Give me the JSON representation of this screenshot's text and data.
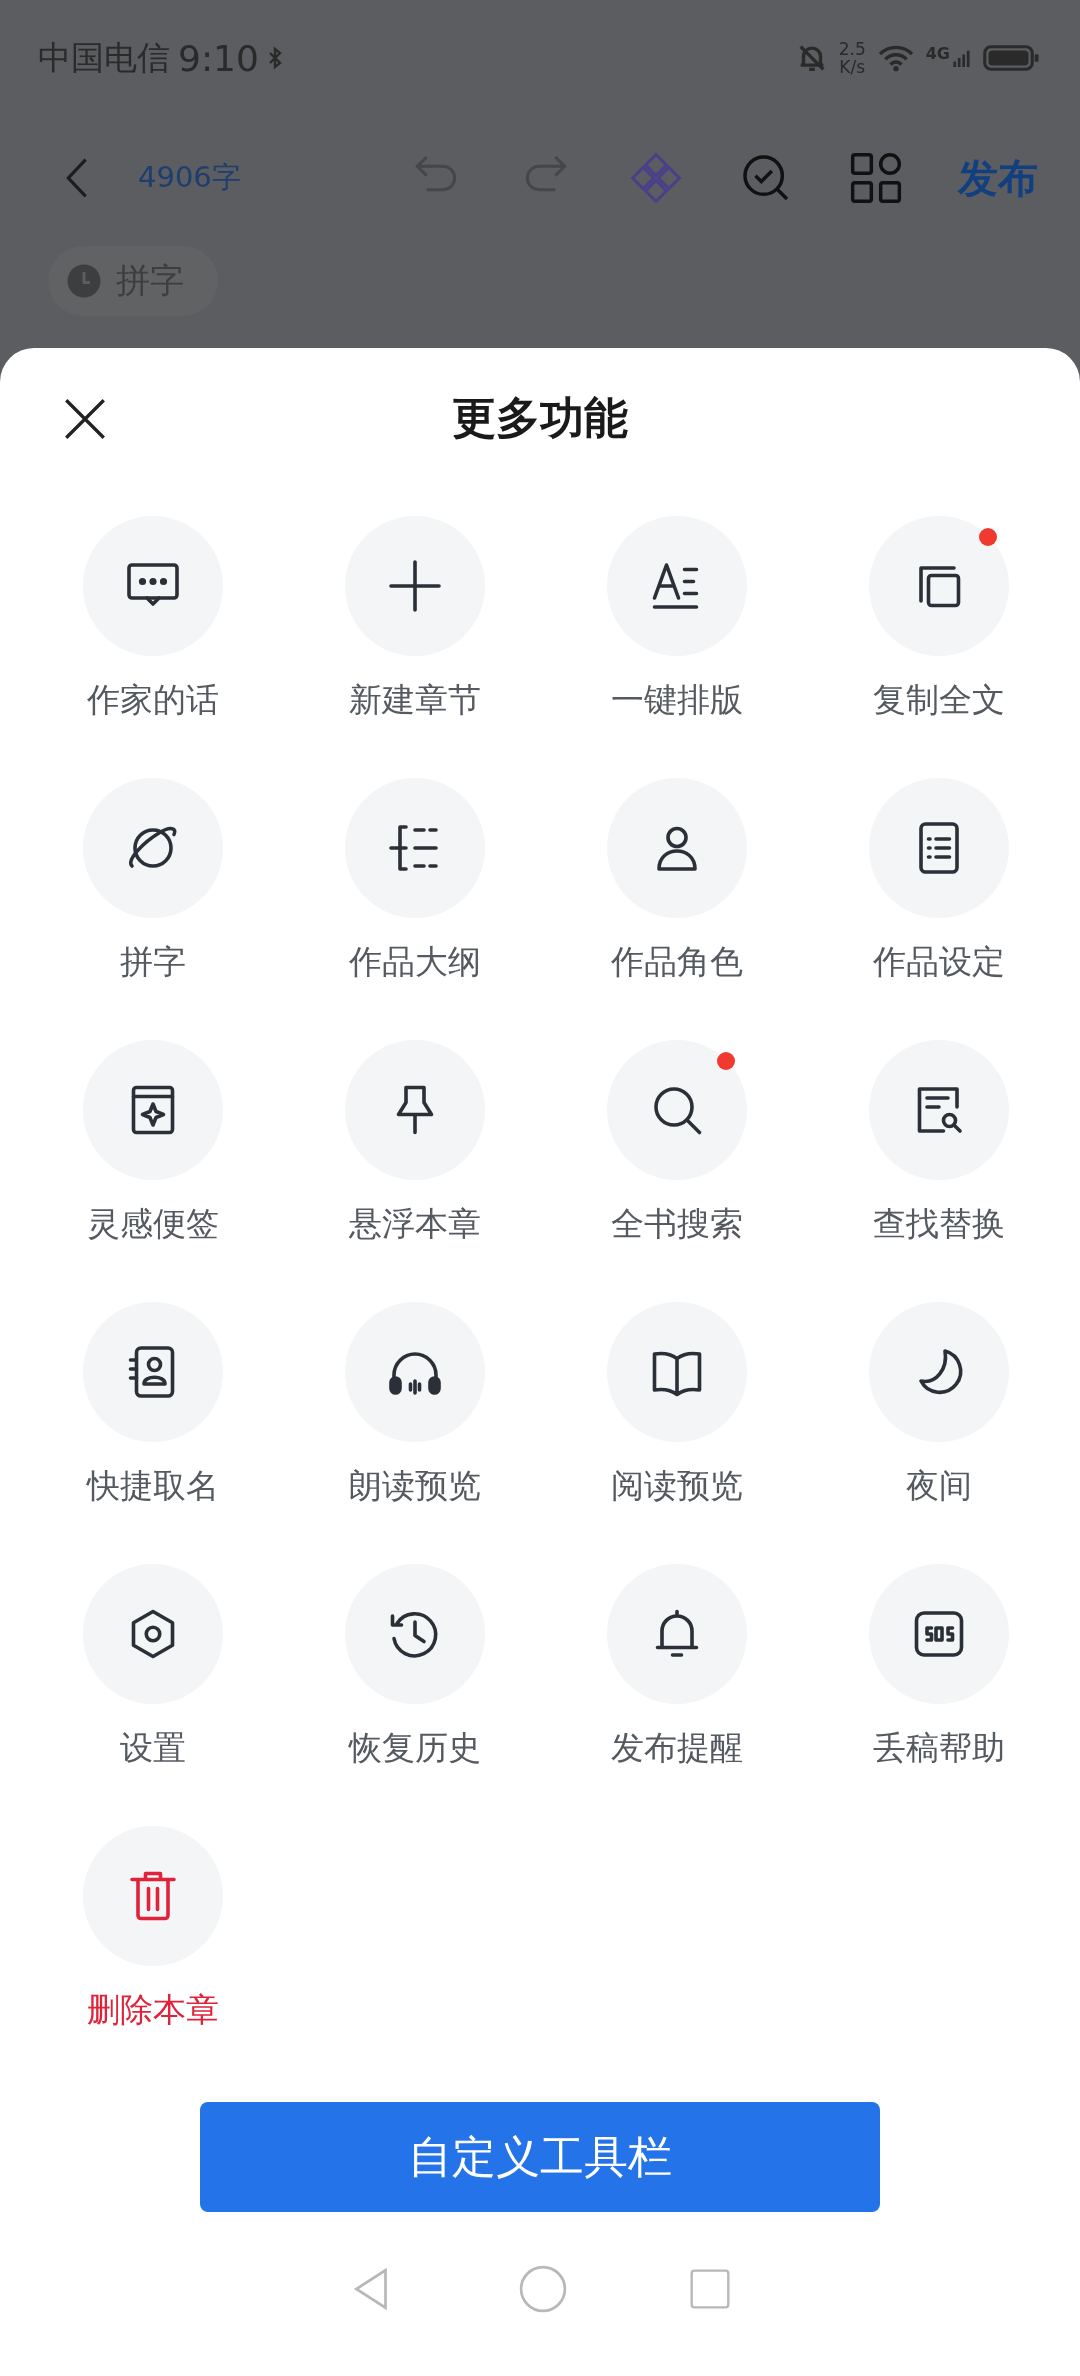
{
  "status_bar": {
    "carrier": "中国电信",
    "time": "9:10",
    "speed_value": "2.5",
    "speed_unit": "K/s",
    "network": "4G"
  },
  "toolbar": {
    "word_count": "4906字",
    "publish": "发布"
  },
  "chip": {
    "label": "拼字"
  },
  "sheet": {
    "title": "更多功能",
    "items": [
      {
        "label": "作家的话",
        "kind": "normal",
        "badge": false
      },
      {
        "label": "新建章节",
        "kind": "normal",
        "badge": false
      },
      {
        "label": "一键排版",
        "kind": "normal",
        "badge": false
      },
      {
        "label": "复制全文",
        "kind": "normal",
        "badge": true
      },
      {
        "label": "拼字",
        "kind": "normal",
        "badge": false
      },
      {
        "label": "作品大纲",
        "kind": "normal",
        "badge": false
      },
      {
        "label": "作品角色",
        "kind": "normal",
        "badge": false
      },
      {
        "label": "作品设定",
        "kind": "normal",
        "badge": false
      },
      {
        "label": "灵感便签",
        "kind": "normal",
        "badge": false
      },
      {
        "label": "悬浮本章",
        "kind": "normal",
        "badge": false
      },
      {
        "label": "全书搜索",
        "kind": "normal",
        "badge": true
      },
      {
        "label": "查找替换",
        "kind": "normal",
        "badge": false
      },
      {
        "label": "快捷取名",
        "kind": "normal",
        "badge": false
      },
      {
        "label": "朗读预览",
        "kind": "normal",
        "badge": false
      },
      {
        "label": "阅读预览",
        "kind": "normal",
        "badge": false
      },
      {
        "label": "夜间",
        "kind": "normal",
        "badge": false
      },
      {
        "label": "设置",
        "kind": "normal",
        "badge": false
      },
      {
        "label": "恢复历史",
        "kind": "normal",
        "badge": false
      },
      {
        "label": "发布提醒",
        "kind": "normal",
        "badge": false
      },
      {
        "label": "丢稿帮助",
        "kind": "normal",
        "badge": false
      },
      {
        "label": "删除本章",
        "kind": "danger",
        "badge": false
      }
    ],
    "customize_button": "自定义工具栏"
  }
}
